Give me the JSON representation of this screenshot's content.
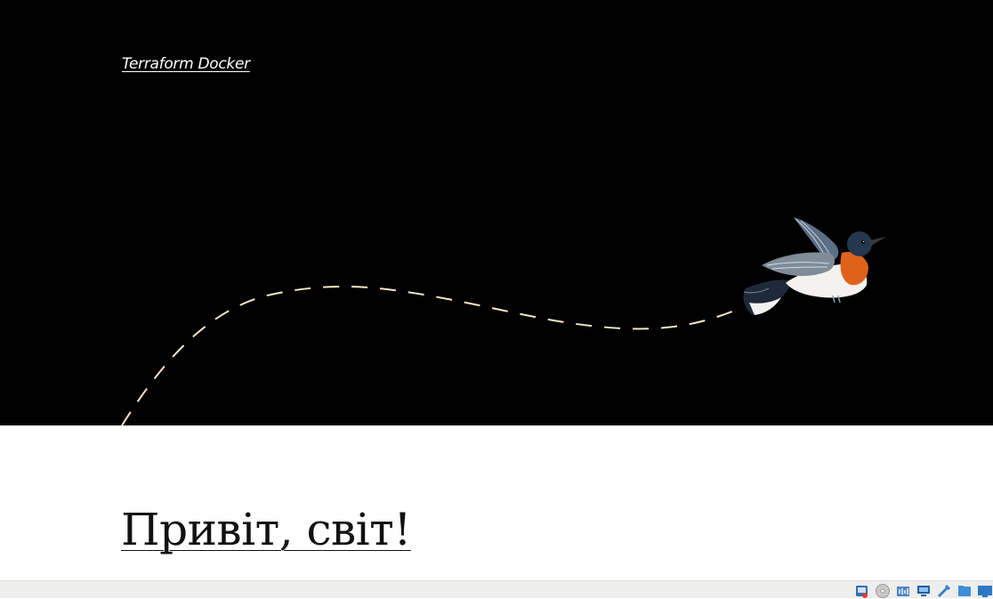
{
  "site": {
    "title": "Terraform Docker"
  },
  "post": {
    "title": "Привіт, світ!"
  },
  "colors": {
    "hero_background": "#000000",
    "flight_path": "#f5e6c8",
    "page_background": "#ffffff",
    "statusbar_background": "#eeeeec"
  },
  "statusbar": {
    "icons": [
      "hard-disk-icon",
      "optical-drive-icon",
      "audio-icon",
      "network-icon",
      "usb-icon",
      "shared-folders-icon",
      "display-icon"
    ]
  }
}
